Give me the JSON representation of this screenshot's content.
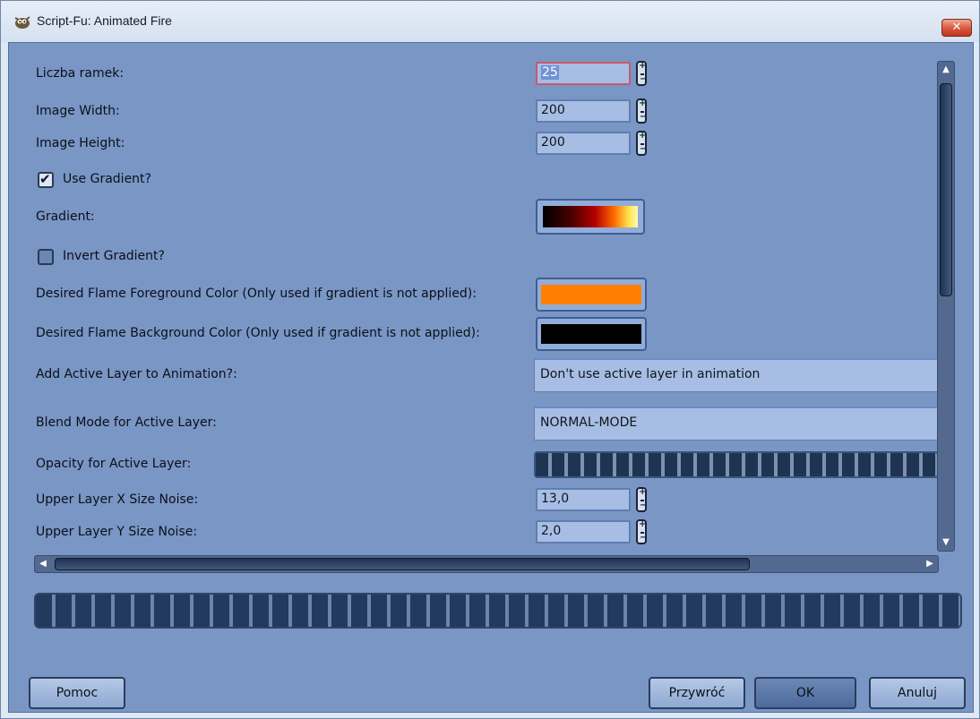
{
  "window": {
    "title": "Script-Fu: Animated Fire",
    "close_label": "✕"
  },
  "fields": {
    "frames": {
      "label": "Liczba ramek:",
      "value": "25"
    },
    "width": {
      "label": "Image Width:",
      "value": "200"
    },
    "height": {
      "label": "Image Height:",
      "value": "200"
    },
    "use_gradient": {
      "label": "Use Gradient?",
      "checked": true
    },
    "gradient": {
      "label": "Gradient:"
    },
    "invert_gradient": {
      "label": "Invert Gradient?",
      "checked": false
    },
    "fg_color": {
      "label": "Desired Flame Foreground Color (Only used if gradient is not applied):",
      "color": "#ff8000"
    },
    "bg_color": {
      "label": "Desired Flame Background Color (Only used if gradient is not applied):",
      "color": "#000000"
    },
    "add_active_layer": {
      "label": "Add Active Layer to Animation?:",
      "value": "Don't use active layer in animation"
    },
    "blend_mode": {
      "label": "Blend Mode for Active Layer:",
      "value": "NORMAL-MODE"
    },
    "opacity": {
      "label": "Opacity for Active Layer:"
    },
    "upper_x_noise": {
      "label": "Upper Layer X Size Noise:",
      "value": "13,0"
    },
    "upper_y_noise": {
      "label": "Upper Layer Y Size Noise:",
      "value": "2,0"
    }
  },
  "buttons": {
    "help": "Pomoc",
    "reset": "Przywróć",
    "ok": "OK",
    "cancel": "Anuluj"
  },
  "icons": {
    "app": "gimp-wilber-icon",
    "scroll_up": "▲",
    "scroll_down": "▼",
    "scroll_left": "◀",
    "scroll_right": "▶"
  }
}
